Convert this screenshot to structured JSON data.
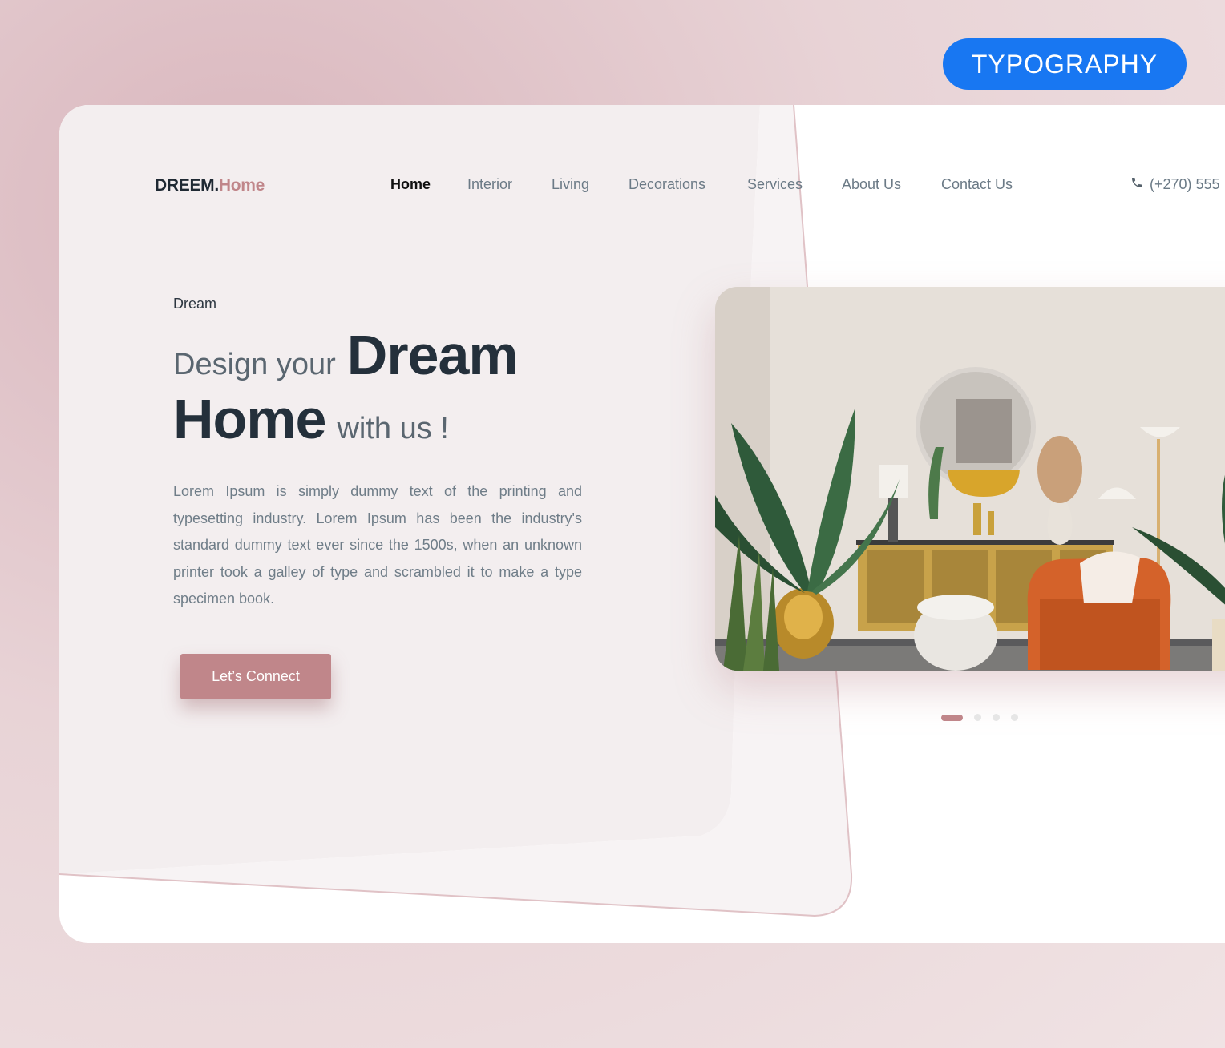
{
  "badge": {
    "label": "TYPOGRAPHY"
  },
  "header": {
    "logo_main": "DREEM.",
    "logo_accent": "Home",
    "nav": [
      {
        "label": "Home",
        "active": true
      },
      {
        "label": "Interior"
      },
      {
        "label": "Living"
      },
      {
        "label": "Decorations"
      },
      {
        "label": "Services"
      },
      {
        "label": "About Us"
      },
      {
        "label": "Contact Us"
      }
    ],
    "phone": "(+270) 555"
  },
  "hero": {
    "eyebrow": "Dream",
    "headline_light_1": "Design your",
    "headline_bold_1": "Dream",
    "headline_bold_2": "Home",
    "headline_light_2": "with us !",
    "description": "Lorem Ipsum is simply dummy text of the printing and typesetting industry. Lorem Ipsum has been the industry's standard dummy text ever since the 1500s, when an unknown printer took a galley of type and scrambled it to make a type specimen book.",
    "cta_label": "Let’s Connect"
  },
  "carousel": {
    "slide_count": 4,
    "active_index": 0
  },
  "colors": {
    "accent": "#c0868a",
    "badge": "#1877f2",
    "heading": "#24303b",
    "nav_text": "#6b7a86"
  }
}
